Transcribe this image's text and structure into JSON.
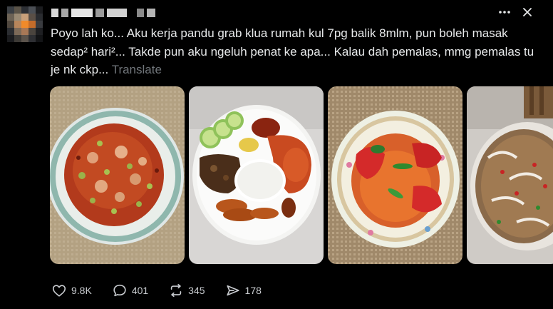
{
  "post": {
    "text": "Poyo lah ko... Aku kerja pandu grab klua rumah kul 7pg balik 8mlm, pun boleh masak sedap² hari²... Takde pun aku ngeluh penat ke apa... Kalau dah pemalas, mmg pemalas tu je nk ckp...",
    "translate_label": "Translate"
  },
  "stats": {
    "likes": "9.8K",
    "replies": "401",
    "reposts": "345",
    "views": "178"
  },
  "icons": {
    "menu": "more-horizontal-icon",
    "close": "close-icon",
    "like": "heart-icon",
    "reply": "reply-icon",
    "repost": "repost-icon",
    "views": "share-icon"
  },
  "colors": {
    "background": "#000000",
    "text": "#e7e9ea",
    "secondary": "#71767b"
  }
}
